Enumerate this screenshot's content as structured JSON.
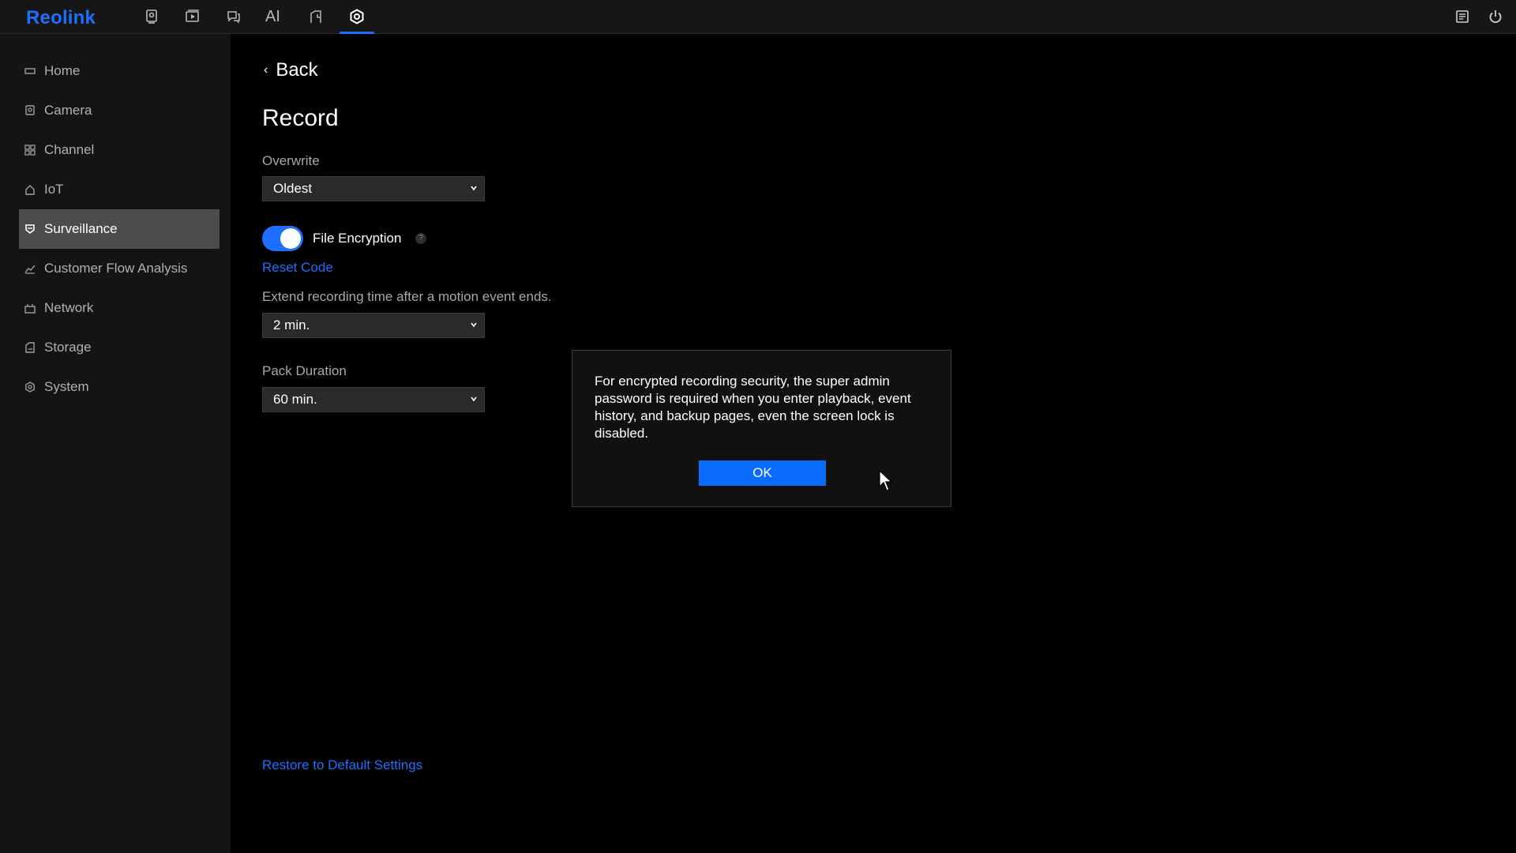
{
  "app": {
    "logo": "Reolink"
  },
  "topbar": {
    "icons": [
      "preview-icon",
      "playback-icon",
      "messages-icon",
      "ai-icon",
      "file-search-icon",
      "settings-icon"
    ],
    "ai_label": "AI",
    "right_icons": [
      "notes-icon",
      "power-icon"
    ],
    "accent_color": "#1f6fff"
  },
  "sidebar": {
    "items": [
      {
        "label": "Home",
        "icon": "home-icon"
      },
      {
        "label": "Camera",
        "icon": "camera-icon"
      },
      {
        "label": "Channel",
        "icon": "channel-grid-icon"
      },
      {
        "label": "IoT",
        "icon": "iot-house-icon"
      },
      {
        "label": "Surveillance",
        "icon": "shield-icon",
        "active": true
      },
      {
        "label": "Customer Flow Analysis",
        "icon": "chart-icon"
      },
      {
        "label": "Network",
        "icon": "network-icon"
      },
      {
        "label": "Storage",
        "icon": "storage-icon"
      },
      {
        "label": "System",
        "icon": "system-gear-icon"
      }
    ]
  },
  "main": {
    "back_label": "Back",
    "title": "Record",
    "overwrite": {
      "label": "Overwrite",
      "value": "Oldest"
    },
    "file_encryption": {
      "label": "File Encryption",
      "enabled": true,
      "help": "?"
    },
    "reset_code_label": "Reset Code",
    "extend": {
      "label": "Extend recording time after a motion event ends.",
      "value": "2 min."
    },
    "pack_duration": {
      "label": "Pack Duration",
      "value": "60 min."
    },
    "restore_label": "Restore to Default Settings"
  },
  "dialog": {
    "message": "For encrypted recording security, the super admin password is required when you enter playback, event history, and backup pages, even the screen lock is disabled.",
    "ok_label": "OK"
  }
}
